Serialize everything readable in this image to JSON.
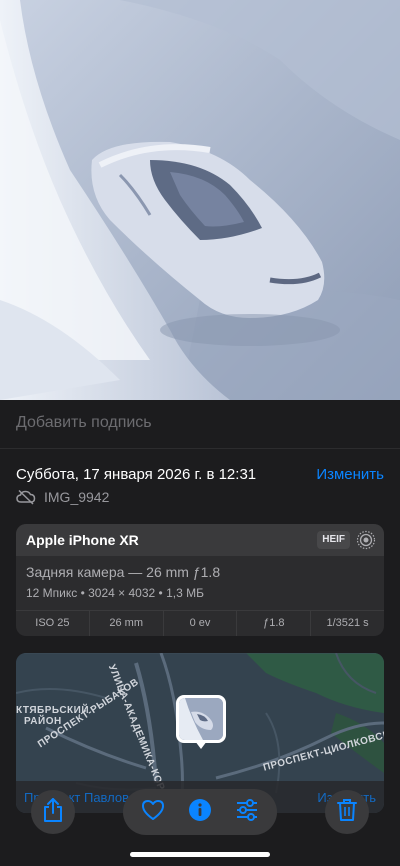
{
  "photo": {
    "description_icon": "snow-covered-car-photo"
  },
  "caption": {
    "placeholder": "Добавить подпись"
  },
  "info": {
    "date": "Суббота, 17 января 2026 г. в 12:31",
    "edit_label": "Изменить",
    "file_name": "IMG_9942",
    "cloud_icon": "cloud-slash-icon"
  },
  "device": {
    "name": "Apple iPhone XR",
    "format": "HEIF",
    "lens": "Задняя камера — 26 mm ƒ1.8",
    "specs": "12 Мпикс  •  3024 × 4032  •  1,3 МБ",
    "exif": [
      "ISO 25",
      "26 mm",
      "0 ev",
      "ƒ1.8",
      "1/3521 s"
    ]
  },
  "map": {
    "district": [
      "КТЯБРЬСКИЙ",
      "РАЙОН"
    ],
    "street_1": "ПРОСПЕКТ-РЫБАКОВ",
    "street_2": "УЛИЦА-АКАДЕМИКА-КОРОЛЁВА",
    "street_3": "ПРОСПЕКТ-ЦИОЛКОВСКОГО",
    "address": "Проспект Павловский",
    "adjust_label": "Изменить"
  },
  "toolbar": {
    "share_icon": "share-icon",
    "favorite_icon": "heart-icon",
    "info_icon": "info-icon",
    "adjust_icon": "sliders-icon",
    "delete_icon": "trash-icon"
  },
  "colors": {
    "accent": "#0a84ff",
    "panel": "#1c1c1e",
    "card": "#2c2c2e"
  }
}
